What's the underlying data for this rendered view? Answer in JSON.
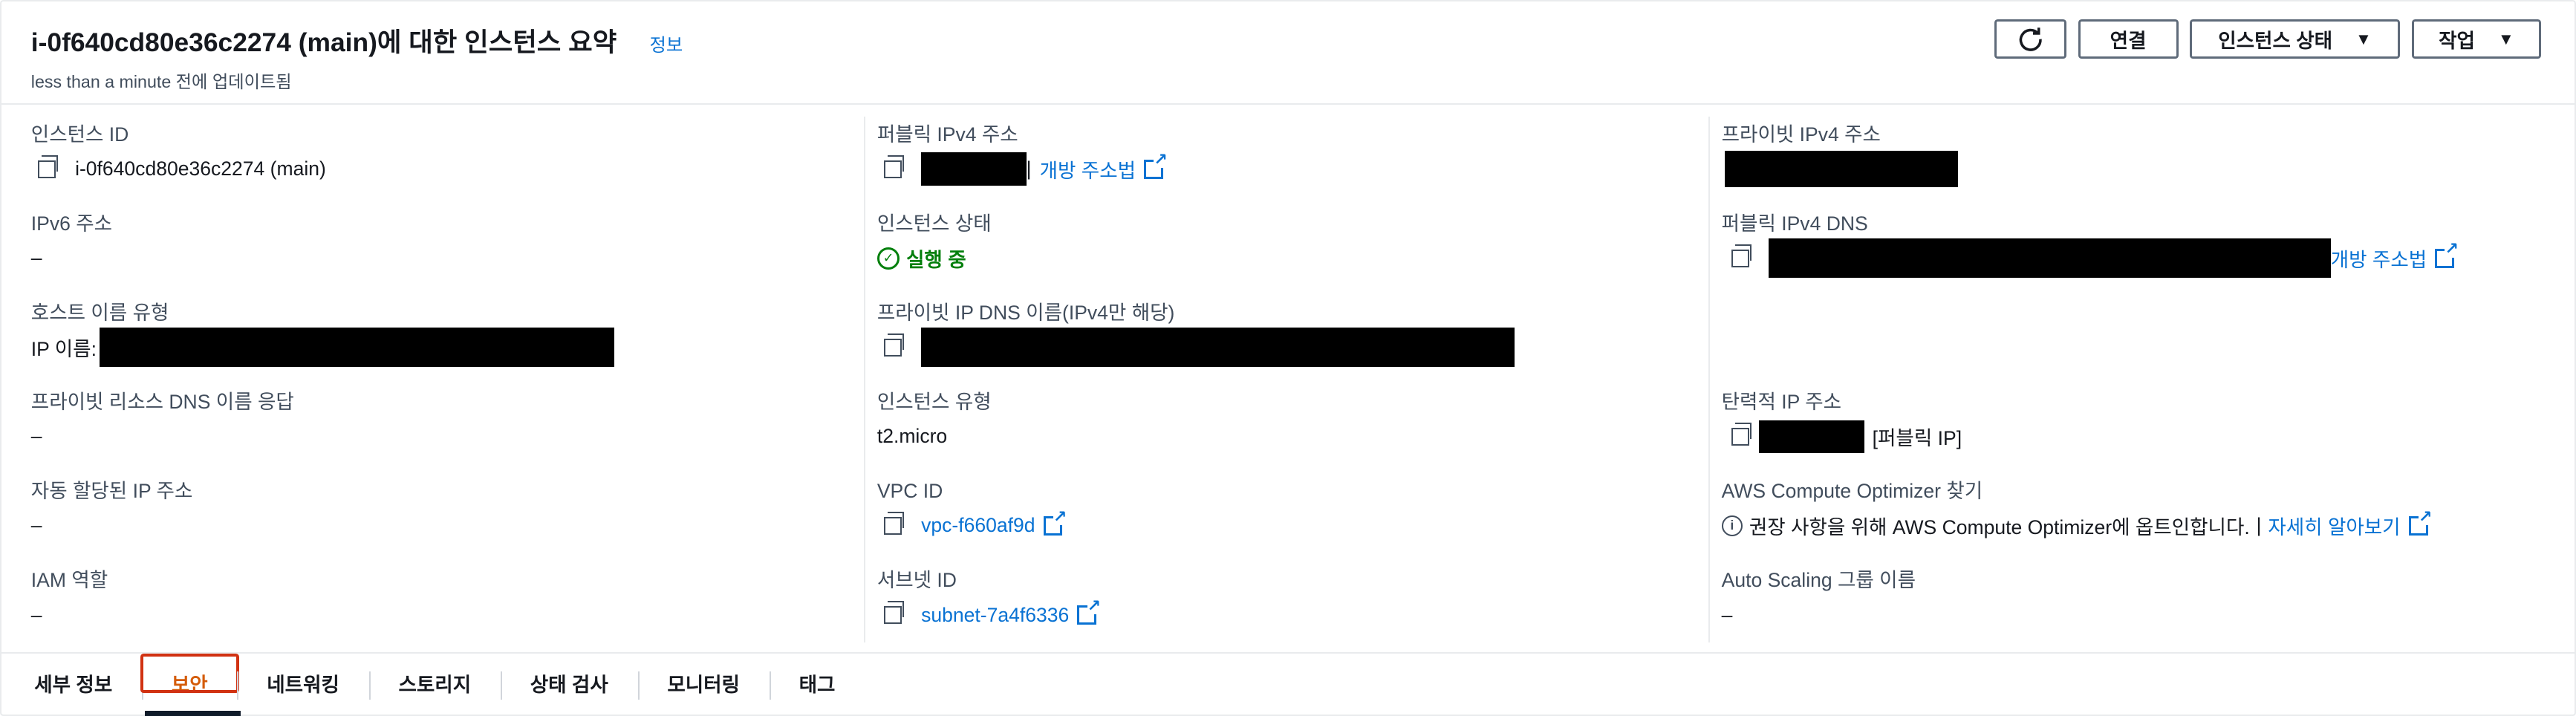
{
  "header": {
    "title": "i-0f640cd80e36c2274 (main)에 대한 인스턴스 요약",
    "info": "정보",
    "updated": "less than a minute 전에 업데이트됨"
  },
  "actions": {
    "refresh_icon": "refresh-icon",
    "connect": "연결",
    "instance_state": "인스턴스 상태",
    "actions": "작업"
  },
  "col1": {
    "instance_id_label": "인스턴스 ID",
    "instance_id_value": "i-0f640cd80e36c2274 (main)",
    "ipv6_label": "IPv6 주소",
    "ipv6_value": "–",
    "hostname_label": "호스트 이름 유형",
    "hostname_value": "IP 이름:",
    "private_dns_answer_label": "프라이빗 리소스 DNS 이름 응답",
    "private_dns_answer_value": "–",
    "auto_ip_label": "자동 할당된 IP 주소",
    "auto_ip_value": "–",
    "iam_label": "IAM 역할",
    "iam_value": "–"
  },
  "col2": {
    "public_ipv4_label": "퍼블릭 IPv4 주소",
    "public_ipv4_sep": "|",
    "open_address": "개방 주소법",
    "state_label": "인스턴스 상태",
    "state_value": "실행 중",
    "private_dns_label": "프라이빗 IP DNS 이름(IPv4만 해당)",
    "type_label": "인스턴스 유형",
    "type_value": "t2.micro",
    "vpc_label": "VPC ID",
    "vpc_value": "vpc-f660af9d",
    "subnet_label": "서브넷 ID",
    "subnet_value": "subnet-7a4f6336"
  },
  "col3": {
    "private_ipv4_label": "프라이빗 IPv4 주소",
    "public_dns_label": "퍼블릭 IPv4 DNS",
    "open_address": "개방 주소법",
    "elastic_label": "탄력적 IP 주소",
    "elastic_suffix": "[퍼블릭 IP]",
    "optimizer_label": "AWS Compute Optimizer 찾기",
    "optimizer_text": "권장 사항을 위해 AWS Compute Optimizer에 옵트인합니다.",
    "optimizer_sep": "|",
    "optimizer_link": "자세히 알아보기",
    "asg_label": "Auto Scaling 그룹 이름",
    "asg_value": "–"
  },
  "tabs": [
    {
      "label": "세부 정보"
    },
    {
      "label": "보안"
    },
    {
      "label": "네트워킹"
    },
    {
      "label": "스토리지"
    },
    {
      "label": "상태 검사"
    },
    {
      "label": "모니터링"
    },
    {
      "label": "태그"
    }
  ],
  "colors": {
    "link": "#0972d3",
    "running": "#037f0c",
    "active_tab": "#d45b07",
    "highlight_box": "#d13212"
  }
}
